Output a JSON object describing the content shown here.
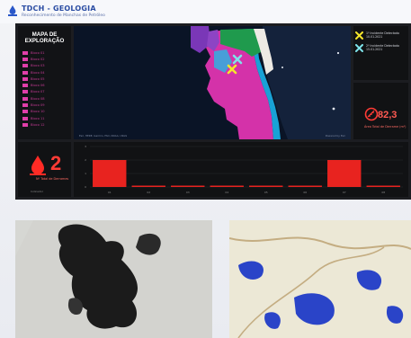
{
  "app": {
    "title": "TDCH - GEOLOGIA",
    "subtitle": "Reconhecimento de Manchas de Petróleo"
  },
  "sidebar": {
    "title_line1": "MAPA DE",
    "title_line2": "EXPLORAÇÃO",
    "legend_items": [
      {
        "label": "Bloco 01"
      },
      {
        "label": "Bloco 02"
      },
      {
        "label": "Bloco 03"
      },
      {
        "label": "Bloco 04"
      },
      {
        "label": "Bloco 05"
      },
      {
        "label": "Bloco 06"
      },
      {
        "label": "Bloco 07"
      },
      {
        "label": "Bloco 08"
      },
      {
        "label": "Bloco 09"
      },
      {
        "label": "Bloco 10"
      },
      {
        "label": "Bloco 11"
      },
      {
        "label": "Bloco 12"
      }
    ]
  },
  "map": {
    "footer_left": "Esri, HERE, Garmin, FAO, NOAA, USGS",
    "footer_right": "Powered by Esri"
  },
  "incidents": [
    {
      "text1": "1º Incidente Detectado",
      "text2": "10.01.2021",
      "color": "#f5e62b"
    },
    {
      "text1": "2º Incidente Detectado",
      "text2": "15.01.2021",
      "color": "#7ee3ea"
    }
  ],
  "area": {
    "value": "82,3",
    "label": "Área Total de Derrame (m²)",
    "icon": "ruler-icon"
  },
  "count": {
    "value": "2",
    "label": "Nº Total de Derrames",
    "footer": "Indicador",
    "icon": "oil-drop-icon"
  },
  "colors": {
    "accent_red": "#e8231f",
    "panel_bg": "#111214",
    "dashboard_bg": "#1c1d21",
    "legend_pink": "#e03ea9"
  },
  "chart_data": {
    "type": "bar",
    "categories": [
      "01",
      "02",
      "03",
      "04",
      "05",
      "06",
      "07",
      "08"
    ],
    "values": [
      2,
      0,
      0,
      0,
      0,
      0,
      2,
      0
    ],
    "ylim": [
      0,
      3
    ],
    "y_ticks": [
      "3",
      "2",
      "1",
      "0"
    ],
    "grid": true,
    "legend": "none"
  }
}
